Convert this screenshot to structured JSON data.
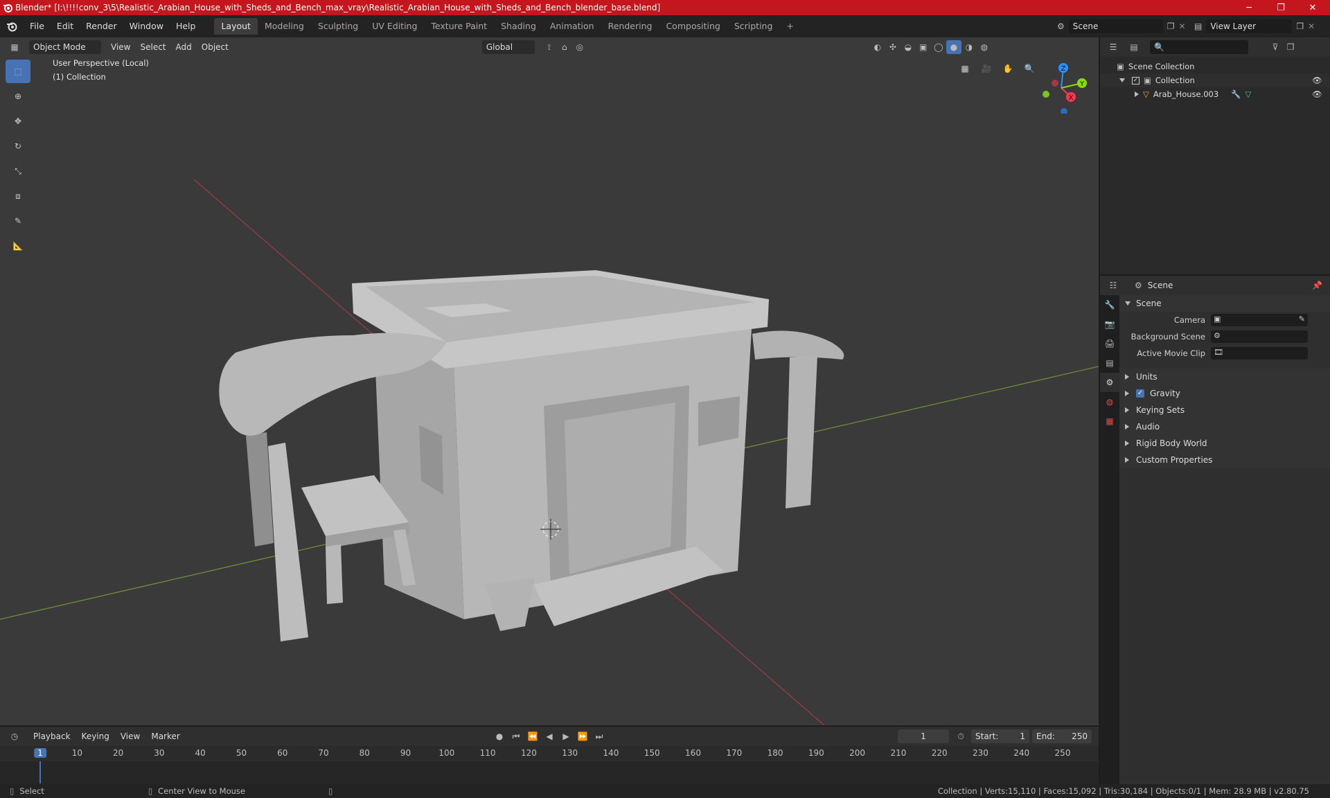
{
  "title_bar": {
    "text": "Blender* [I:\\!!!!conv_3\\5\\Realistic_Arabian_House_with_Sheds_and_Bench_max_vray\\Realistic_Arabian_House_with_Sheds_and_Bench_blender_base.blend]",
    "minimize": "─",
    "maximize": "❐",
    "close": "✕"
  },
  "menu": {
    "file": "File",
    "edit": "Edit",
    "render": "Render",
    "window": "Window",
    "help": "Help"
  },
  "workspaces": [
    {
      "label": "Layout",
      "active": true
    },
    {
      "label": "Modeling"
    },
    {
      "label": "Sculpting"
    },
    {
      "label": "UV Editing"
    },
    {
      "label": "Texture Paint"
    },
    {
      "label": "Shading"
    },
    {
      "label": "Animation"
    },
    {
      "label": "Rendering"
    },
    {
      "label": "Compositing"
    },
    {
      "label": "Scripting"
    }
  ],
  "add_workspace": "+",
  "scene_selector": "Scene",
  "view_layer_selector": "View Layer",
  "viewport_header": {
    "mode": "Object Mode",
    "view": "View",
    "select": "Select",
    "add": "Add",
    "object": "Object",
    "orientation": "Global"
  },
  "viewport": {
    "perspective_label": "User Perspective (Local)",
    "collection_label": "(1) Collection",
    "gizmo": {
      "x": "X",
      "y": "Y",
      "z": "Z"
    }
  },
  "outliner": {
    "scene_collection": "Scene Collection",
    "collection": "Collection",
    "object": "Arab_House.003"
  },
  "properties": {
    "header": "Scene",
    "section_title": "Scene",
    "camera_label": "Camera",
    "background_scene_label": "Background Scene",
    "active_movie_clip_label": "Active Movie Clip",
    "panels": [
      {
        "label": "Units",
        "checkbox": false
      },
      {
        "label": "Gravity",
        "checkbox": true
      },
      {
        "label": "Keying Sets",
        "checkbox": false
      },
      {
        "label": "Audio",
        "checkbox": false
      },
      {
        "label": "Rigid Body World",
        "checkbox": false
      },
      {
        "label": "Custom Properties",
        "checkbox": false
      }
    ]
  },
  "timeline": {
    "playback": "Playback",
    "keying": "Keying",
    "view": "View",
    "marker": "Marker",
    "current_frame": "1",
    "start_label": "Start:",
    "start_value": "1",
    "end_label": "End:",
    "end_value": "250",
    "ruler_ticks": [
      "1",
      "10",
      "20",
      "30",
      "40",
      "50",
      "60",
      "70",
      "80",
      "90",
      "100",
      "110",
      "120",
      "130",
      "140",
      "150",
      "160",
      "170",
      "180",
      "190",
      "200",
      "210",
      "220",
      "230",
      "240",
      "250"
    ]
  },
  "status_bar": {
    "select": "Select",
    "center_view": "Center View to Mouse",
    "stats": "Collection | Verts:15,110 | Faces:15,092 | Tris:30,184 | Objects:0/1 | Mem: 28.9 MB | v2.80.75"
  },
  "colors": {
    "title_bar": "#c4161c",
    "accent": "#4772b3",
    "viewport_bg": "#3a3a3a",
    "axis_x": "#ff3352",
    "axis_y": "#8bdc00",
    "axis_z": "#2890ff"
  }
}
